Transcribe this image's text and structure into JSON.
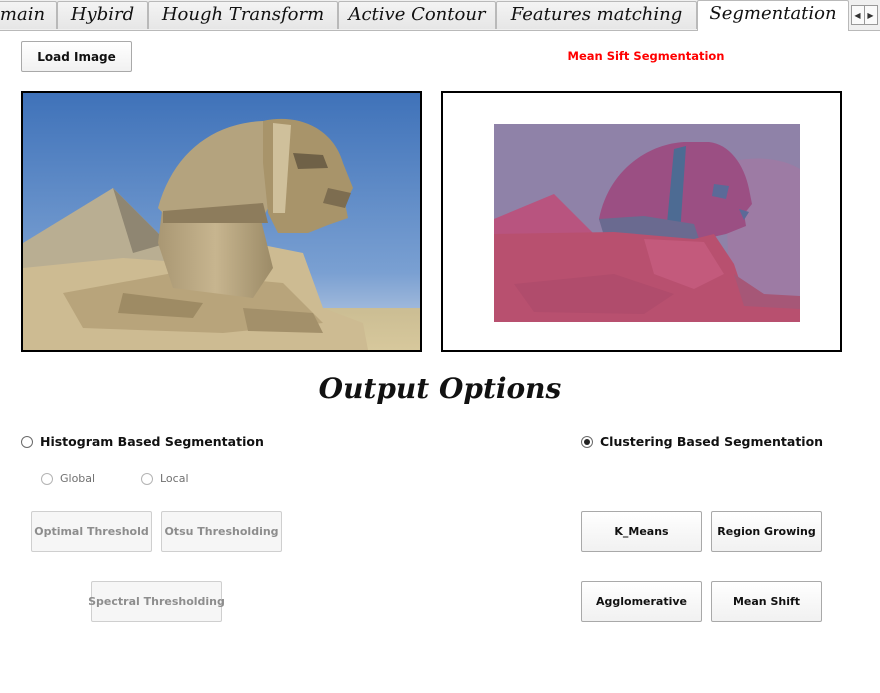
{
  "tabs": [
    {
      "label": "main"
    },
    {
      "label": "Hybird"
    },
    {
      "label": "Hough Transform"
    },
    {
      "label": "Active Contour"
    },
    {
      "label": "Features matching"
    },
    {
      "label": "Segmentation"
    }
  ],
  "active_tab": "Segmentation",
  "toolbar": {
    "load_label": "Load Image",
    "result_title": "Mean Sift Segmentation"
  },
  "colors": {
    "result_title": "#ff0000",
    "panel_border": "#000000"
  },
  "output": {
    "heading": "Output Options",
    "histogram": {
      "label": "Histogram Based Segmentation",
      "selected": false,
      "sub_options": [
        {
          "label": "Global",
          "selected": false
        },
        {
          "label": "Local",
          "selected": false
        }
      ],
      "buttons": {
        "optimal": "Optimal Threshold",
        "otsu": "Otsu Thresholding",
        "spectral": "Spectral Thresholding"
      }
    },
    "clustering": {
      "label": "Clustering Based Segmentation",
      "selected": true,
      "buttons": {
        "kmeans": "K_Means",
        "region_growing": "Region Growing",
        "agglomerative": "Agglomerative",
        "mean_shift": "Mean Shift"
      }
    }
  }
}
